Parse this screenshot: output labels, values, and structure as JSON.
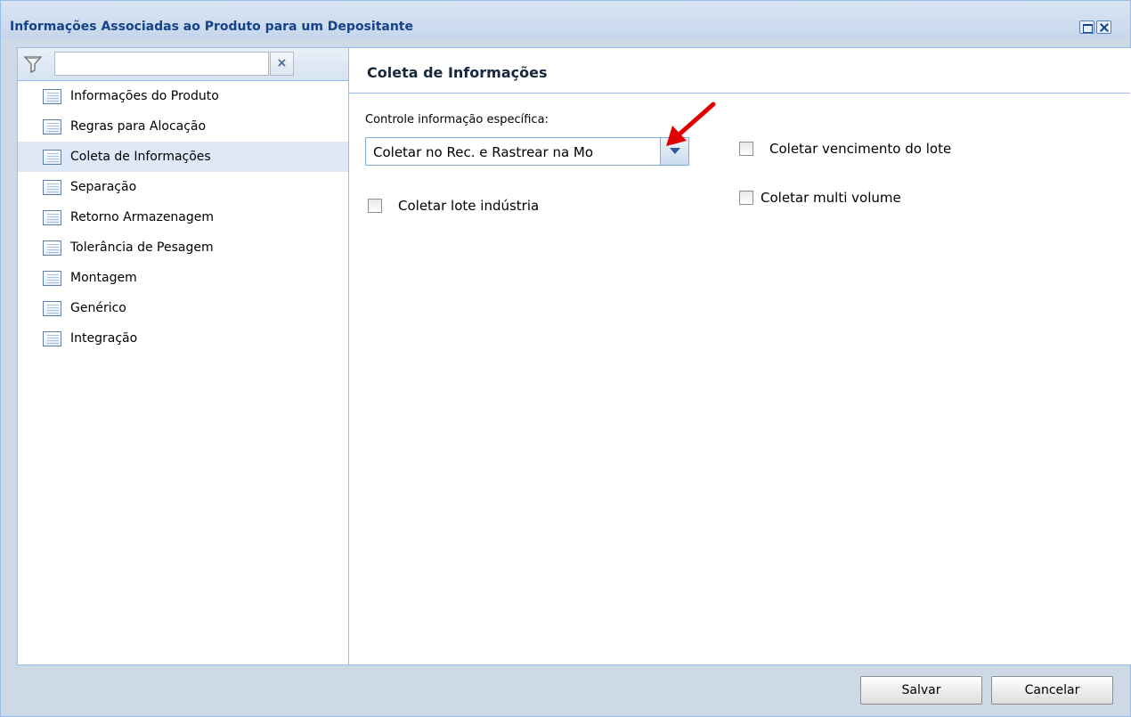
{
  "window": {
    "title": "Informações Associadas ao Produto para um Depositante"
  },
  "filter": {
    "value": "",
    "clear_label": "×"
  },
  "nav": {
    "items": [
      {
        "label": "Informações do Produto"
      },
      {
        "label": "Regras para Alocação"
      },
      {
        "label": "Coleta de Informações",
        "active": true
      },
      {
        "label": "Separação"
      },
      {
        "label": "Retorno Armazenagem"
      },
      {
        "label": "Tolerância de Pesagem"
      },
      {
        "label": "Montagem"
      },
      {
        "label": "Genérico"
      },
      {
        "label": "Integração"
      }
    ]
  },
  "panel": {
    "title": "Coleta de Informações",
    "field_label": "Controle informação específica:",
    "combo_value": "Coletar no Rec. e Rastrear na Mo",
    "checkboxes": {
      "lote_industria": {
        "label": "Coletar lote indústria",
        "checked": false
      },
      "vencimento_lote": {
        "label": "Coletar vencimento do lote",
        "checked": false
      },
      "multi_volume": {
        "label": "Coletar multi volume",
        "checked": false
      }
    }
  },
  "buttons": {
    "save": "Salvar",
    "cancel": "Cancelar"
  },
  "colors": {
    "title_text": "#15428b",
    "border": "#99bbe8",
    "active_row": "#dfe8f6",
    "arrow": "#e00000"
  }
}
